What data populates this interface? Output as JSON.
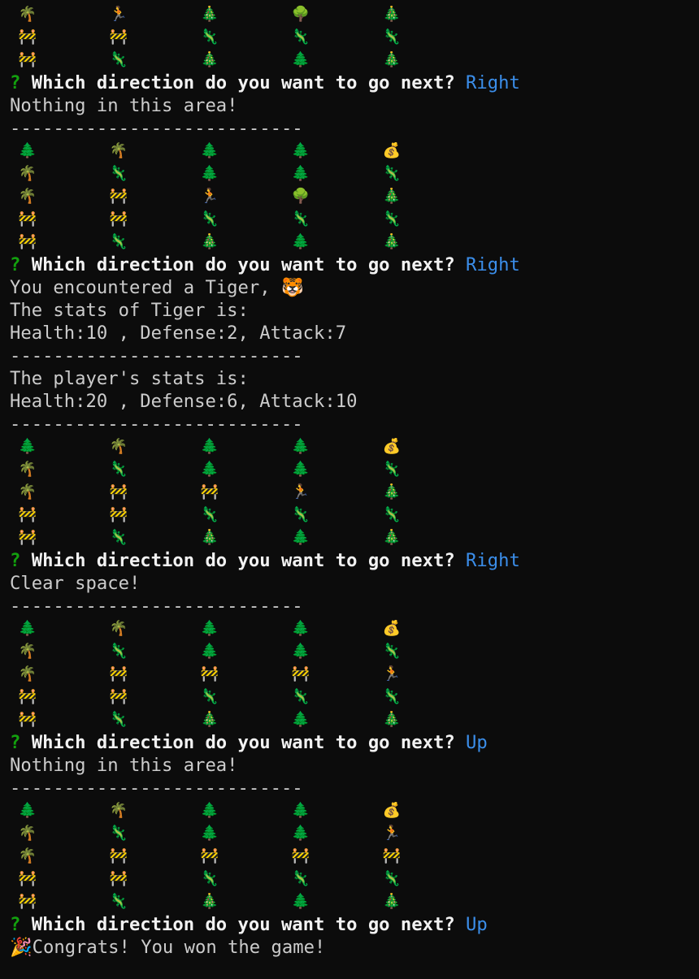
{
  "terminal": {
    "question_mark": "?",
    "prompt": "Which direction do you want to go next?",
    "separator": "---------------------------",
    "colors": {
      "background": "#0c0c0c",
      "text": "#cccccc",
      "prompt_mark": "#13a10e",
      "prompt_text": "#f2f2f2",
      "answer": "#3b8eea"
    },
    "icon_legend": {
      "🌴": "palm-tree-icon",
      "🏃": "player-icon",
      "🎄": "christmas-tree-icon",
      "🌳": "tree-icon",
      "🌲": "pine-tree-icon",
      "🚧": "barrier-icon",
      "🦎": "lizard-icon",
      "💰": "money-bag-icon",
      "🐯": "tiger-icon",
      "🎉": "party-popper-icon"
    },
    "entries": [
      {
        "type": "grid",
        "rows": [
          [
            "🌴",
            "🏃",
            "🎄",
            "🌳",
            "🎄"
          ],
          [
            "🚧",
            "🚧",
            "🦎",
            "🦎",
            "🦎"
          ],
          [
            "🚧",
            "🦎",
            "🎄",
            "🌲",
            "🎄"
          ]
        ]
      },
      {
        "type": "prompt",
        "answer": "Right"
      },
      {
        "type": "text",
        "text": "Nothing in this area!"
      },
      {
        "type": "separator"
      },
      {
        "type": "grid",
        "rows": [
          [
            "🌲",
            "🌴",
            "🌲",
            "🌲",
            "💰"
          ],
          [
            "🌴",
            "🦎",
            "🌲",
            "🌲",
            "🦎"
          ],
          [
            "🌴",
            "🚧",
            "🏃",
            "🌳",
            "🎄"
          ],
          [
            "🚧",
            "🚧",
            "🦎",
            "🦎",
            "🦎"
          ],
          [
            "🚧",
            "🦎",
            "🎄",
            "🌲",
            "🎄"
          ]
        ]
      },
      {
        "type": "prompt",
        "answer": "Right"
      },
      {
        "type": "text",
        "text": "You encountered a Tiger, 🐯"
      },
      {
        "type": "text",
        "text": "The stats of Tiger is:"
      },
      {
        "type": "text",
        "text": "Health:10 , Defense:2, Attack:7"
      },
      {
        "type": "separator"
      },
      {
        "type": "text",
        "text": "The player's stats is:"
      },
      {
        "type": "text",
        "text": "Health:20 , Defense:6, Attack:10"
      },
      {
        "type": "separator"
      },
      {
        "type": "grid",
        "rows": [
          [
            "🌲",
            "🌴",
            "🌲",
            "🌲",
            "💰"
          ],
          [
            "🌴",
            "🦎",
            "🌲",
            "🌲",
            "🦎"
          ],
          [
            "🌴",
            "🚧",
            "🚧",
            "🏃",
            "🎄"
          ],
          [
            "🚧",
            "🚧",
            "🦎",
            "🦎",
            "🦎"
          ],
          [
            "🚧",
            "🦎",
            "🎄",
            "🌲",
            "🎄"
          ]
        ]
      },
      {
        "type": "prompt",
        "answer": "Right"
      },
      {
        "type": "text",
        "text": "Clear space!"
      },
      {
        "type": "separator"
      },
      {
        "type": "grid",
        "rows": [
          [
            "🌲",
            "🌴",
            "🌲",
            "🌲",
            "💰"
          ],
          [
            "🌴",
            "🦎",
            "🌲",
            "🌲",
            "🦎"
          ],
          [
            "🌴",
            "🚧",
            "🚧",
            "🚧",
            "🏃"
          ],
          [
            "🚧",
            "🚧",
            "🦎",
            "🦎",
            "🦎"
          ],
          [
            "🚧",
            "🦎",
            "🎄",
            "🌲",
            "🎄"
          ]
        ]
      },
      {
        "type": "prompt",
        "answer": "Up"
      },
      {
        "type": "text",
        "text": "Nothing in this area!"
      },
      {
        "type": "separator"
      },
      {
        "type": "grid",
        "rows": [
          [
            "🌲",
            "🌴",
            "🌲",
            "🌲",
            "💰"
          ],
          [
            "🌴",
            "🦎",
            "🌲",
            "🌲",
            "🏃"
          ],
          [
            "🌴",
            "🚧",
            "🚧",
            "🚧",
            "🚧"
          ],
          [
            "🚧",
            "🚧",
            "🦎",
            "🦎",
            "🦎"
          ],
          [
            "🚧",
            "🦎",
            "🎄",
            "🌲",
            "🎄"
          ]
        ]
      },
      {
        "type": "prompt",
        "answer": "Up"
      },
      {
        "type": "text",
        "text": "🎉Congrats! You won the game!"
      }
    ]
  }
}
